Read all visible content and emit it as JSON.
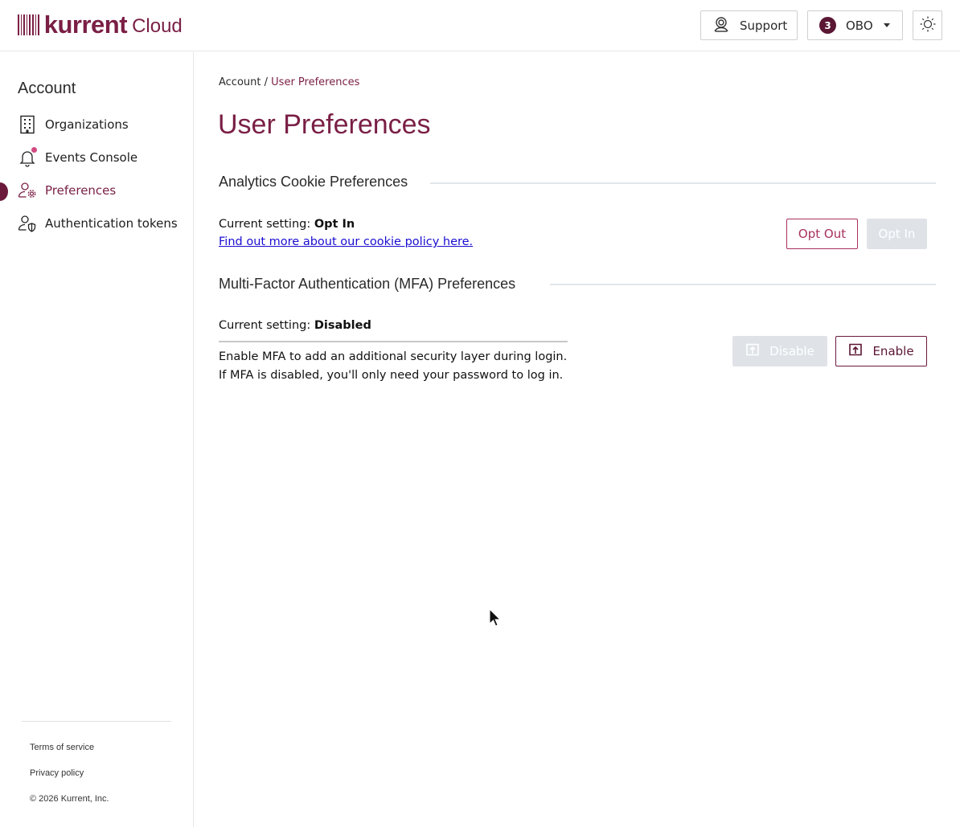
{
  "header": {
    "logo_word": "kurrent",
    "logo_suffix": "Cloud",
    "support_label": "Support",
    "org_badge": "3",
    "org_label": "OBO"
  },
  "sidebar": {
    "title": "Account",
    "items": [
      {
        "label": "Organizations",
        "icon": "building-icon"
      },
      {
        "label": "Events Console",
        "icon": "bell-icon"
      },
      {
        "label": "Preferences",
        "icon": "user-settings-icon"
      },
      {
        "label": "Authentication tokens",
        "icon": "user-shield-icon"
      }
    ],
    "active_index": 2,
    "footer": {
      "terms": "Terms of service",
      "privacy": "Privacy policy",
      "copyright": "© 2026 Kurrent, Inc."
    }
  },
  "main": {
    "breadcrumb": {
      "root": "Account",
      "separator": " / ",
      "current": "User Preferences"
    },
    "title": "User Preferences",
    "analytics": {
      "heading": "Analytics Cookie Preferences",
      "setting_prefix": "Current setting: ",
      "setting_value": "Opt In",
      "link_text": "Find out more about our cookie policy here.",
      "opt_out_label": "Opt Out",
      "opt_in_label": "Opt In"
    },
    "mfa": {
      "heading": "Multi-Factor Authentication (MFA) Preferences",
      "setting_prefix": "Current setting: ",
      "setting_value": "Disabled",
      "desc_line1": "Enable MFA to add an additional security layer during login.",
      "desc_line2": "If MFA is disabled, you'll only need your password to log in.",
      "disable_label": "Disable",
      "enable_label": "Enable"
    }
  },
  "colors": {
    "brand": "#7a1f45",
    "accent_pink": "#a9305f",
    "disabled_bg": "#dfe3e8",
    "link": "#1a0dd1"
  }
}
